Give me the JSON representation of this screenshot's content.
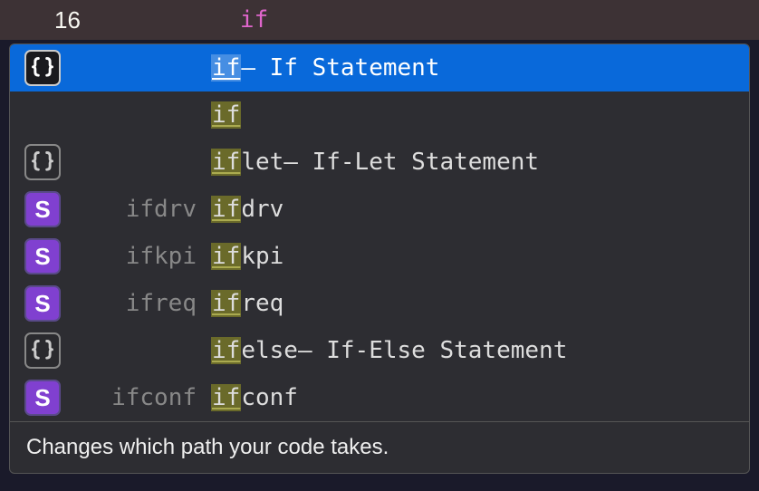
{
  "editor": {
    "line_number": "16",
    "typed_text": "if"
  },
  "autocomplete": {
    "items": [
      {
        "icon_type": "braces",
        "module": "",
        "match": "if",
        "suffix": "",
        "desc_sep": " – ",
        "desc": "If Statement",
        "selected": true
      },
      {
        "icon_type": "none",
        "module": "",
        "match": "if",
        "suffix": "",
        "desc_sep": "",
        "desc": "",
        "selected": false
      },
      {
        "icon_type": "braces",
        "module": "",
        "match": "if",
        "suffix": "let",
        "desc_sep": " – ",
        "desc": "If-Let Statement",
        "selected": false
      },
      {
        "icon_type": "s",
        "module": "ifdrv",
        "match": "if",
        "suffix": "drv",
        "desc_sep": "",
        "desc": "",
        "selected": false
      },
      {
        "icon_type": "s",
        "module": "ifkpi",
        "match": "if",
        "suffix": "kpi",
        "desc_sep": "",
        "desc": "",
        "selected": false
      },
      {
        "icon_type": "s",
        "module": "ifreq",
        "match": "if",
        "suffix": "req",
        "desc_sep": "",
        "desc": "",
        "selected": false
      },
      {
        "icon_type": "braces",
        "module": "",
        "match": "if",
        "suffix": "else",
        "desc_sep": " – ",
        "desc": "If-Else Statement",
        "selected": false
      },
      {
        "icon_type": "s",
        "module": "ifconf",
        "match": "if",
        "suffix": "conf",
        "desc_sep": "",
        "desc": "",
        "selected": false
      }
    ],
    "documentation": "Changes which path your code takes."
  }
}
